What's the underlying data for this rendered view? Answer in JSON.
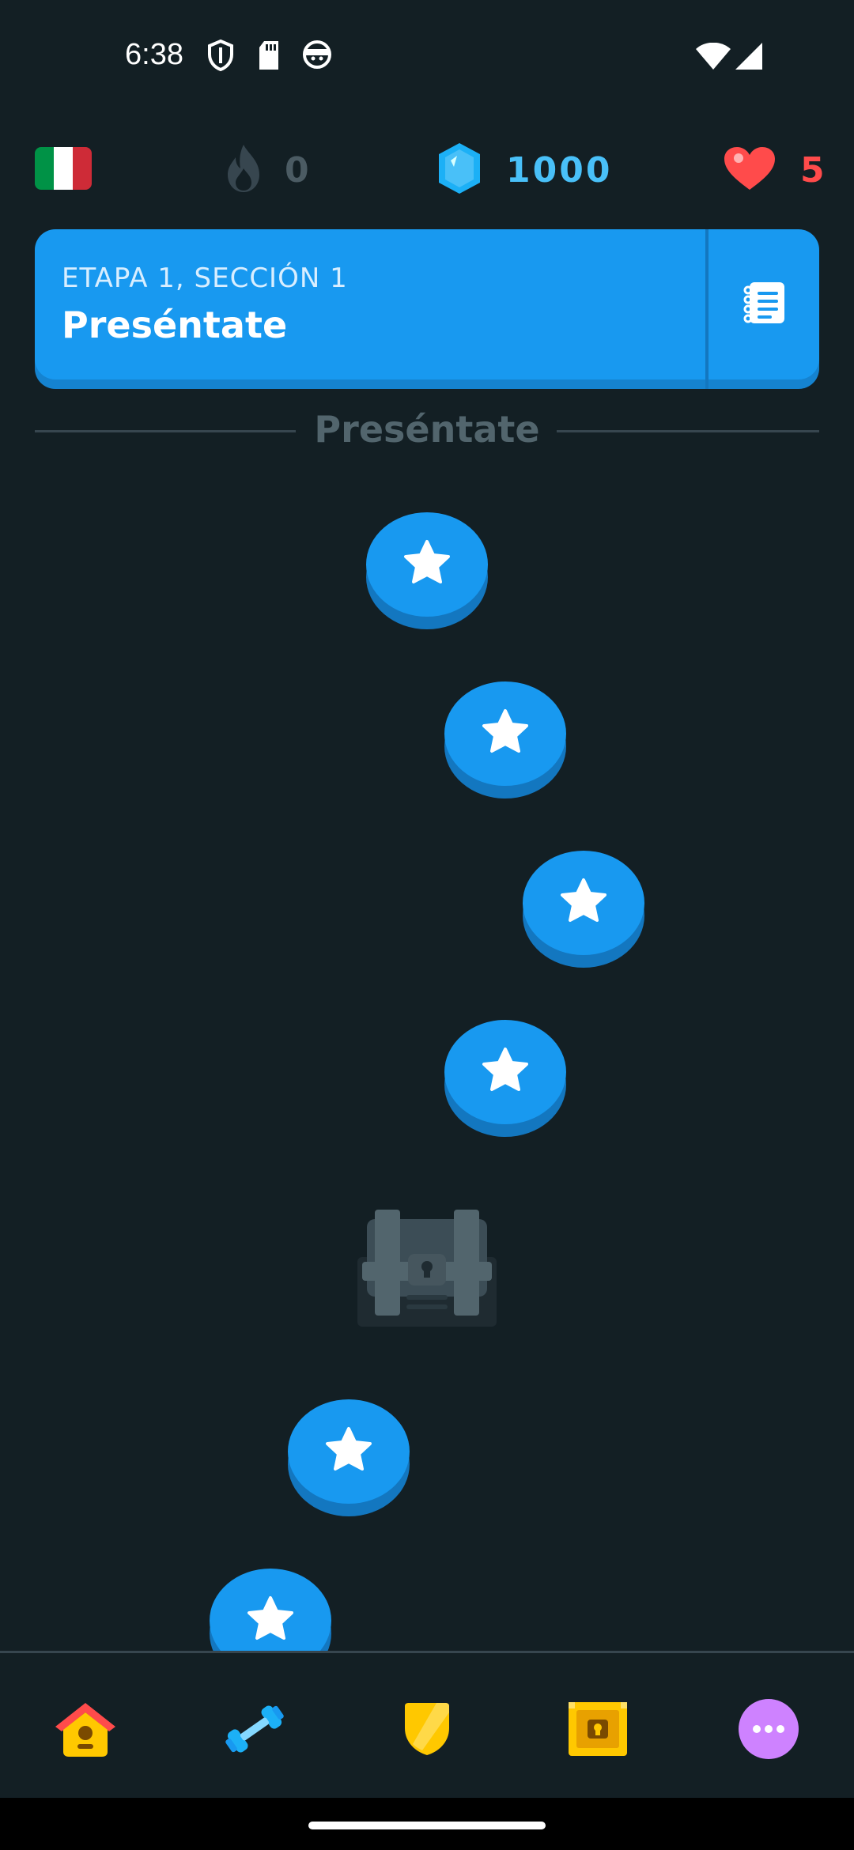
{
  "status_bar": {
    "time": "6:38",
    "left_icons": [
      "shield-icon",
      "sd-card-icon",
      "face-icon"
    ],
    "right_icons": [
      "wifi-icon",
      "signal-icon"
    ]
  },
  "top_bar": {
    "course_flag": "italy-flag-icon",
    "streak": {
      "icon": "fire-icon",
      "value": "0",
      "color": "#4B5B63"
    },
    "gems": {
      "icon": "gem-icon",
      "value": "1000",
      "color": "#49C0F8"
    },
    "hearts": {
      "icon": "heart-icon",
      "value": "5",
      "color": "#FF4B4B"
    }
  },
  "unit_banner": {
    "subtitle": "ETAPA 1, SECCIÓN 1",
    "title": "Preséntate",
    "guide_icon": "notebook-icon",
    "color": "#1899F0"
  },
  "section": {
    "title": "Preséntate"
  },
  "path": {
    "lessons": [
      {
        "icon": "star-icon",
        "state": "active"
      },
      {
        "icon": "star-icon",
        "state": "active"
      },
      {
        "icon": "star-icon",
        "state": "active"
      },
      {
        "icon": "star-icon",
        "state": "active"
      },
      {
        "icon": "chest-icon",
        "state": "locked"
      },
      {
        "icon": "star-icon",
        "state": "active"
      },
      {
        "icon": "star-icon",
        "state": "active"
      }
    ]
  },
  "bottom_nav": {
    "items": [
      {
        "name": "home",
        "icon": "home-icon",
        "selected": true
      },
      {
        "name": "practice",
        "icon": "dumbbell-icon"
      },
      {
        "name": "leagues",
        "icon": "shield-badge-icon"
      },
      {
        "name": "shop",
        "icon": "treasure-chest-icon"
      },
      {
        "name": "more",
        "icon": "more-icon"
      }
    ]
  }
}
